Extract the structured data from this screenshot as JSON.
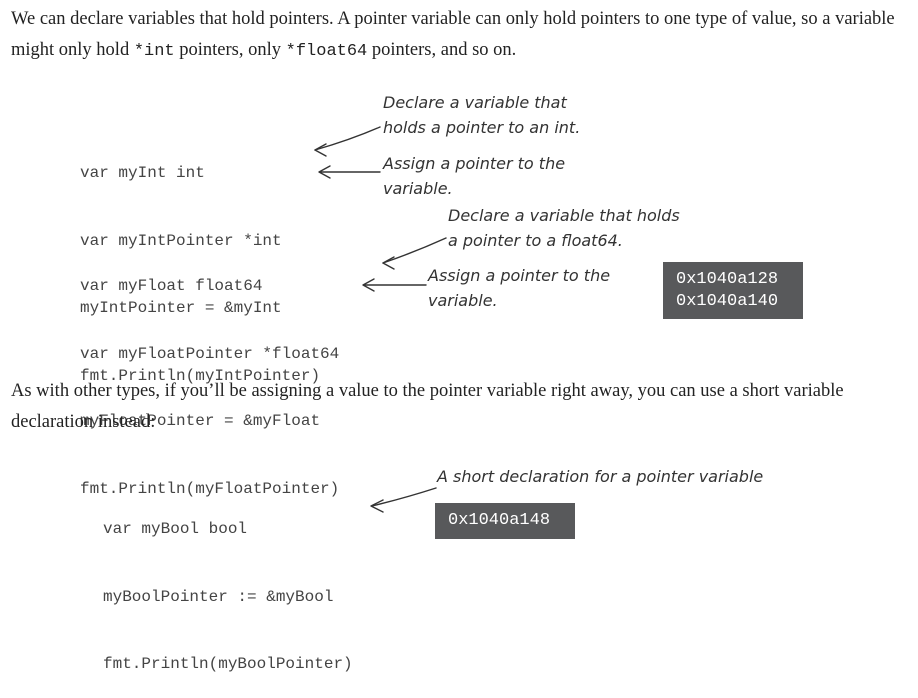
{
  "intro": {
    "before_int": "We can declare variables that hold pointers. A pointer variable can only hold pointers to one type of value, so a variable might only hold ",
    "code_int": "*int",
    "between": " pointers, only ",
    "code_float": "*float64",
    "after": " pointers, and so on."
  },
  "example1": {
    "code_lines": [
      "var myInt int",
      "var myIntPointer *int",
      "myIntPointer = &myInt",
      "fmt.Println(myIntPointer)"
    ],
    "annotations": {
      "declare": "Declare a variable that\nholds a pointer to an int.",
      "assign": "Assign a pointer to the\nvariable."
    }
  },
  "example2": {
    "code_lines": [
      "var myFloat float64",
      "var myFloatPointer *float64",
      "myFloatPointer = &myFloat",
      "fmt.Println(myFloatPointer)"
    ],
    "annotations": {
      "declare": "Declare a variable that holds\na pointer to a float64.",
      "assign": "Assign a pointer to the\nvariable."
    },
    "output": [
      "0x1040a128",
      "0x1040a140"
    ]
  },
  "middle_paragraph": "As with other types, if you’ll be assigning a value to the pointer variable right away, you can use a short variable declaration instead:",
  "example3": {
    "code_lines": [
      "var myBool bool",
      "myBoolPointer := &myBool",
      "fmt.Println(myBoolPointer)"
    ],
    "annotation": "A short declaration for a pointer variable",
    "output": [
      "0x1040a148"
    ]
  }
}
